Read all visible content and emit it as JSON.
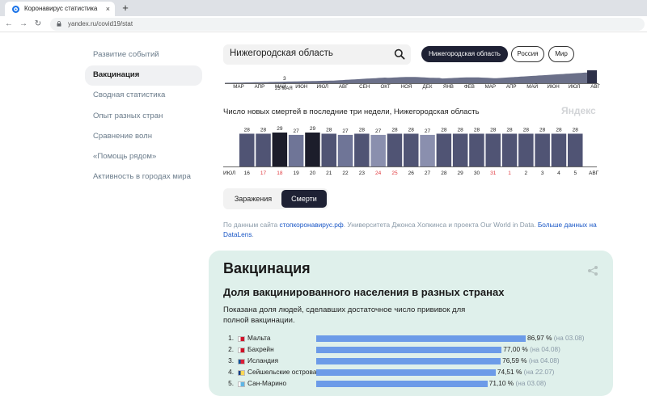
{
  "browser": {
    "tab_title": "Коронавирус статистика",
    "tab_close": "×",
    "new_tab": "+",
    "url": "yandex.ru/covid19/stat"
  },
  "sidebar": {
    "items": [
      {
        "label": "Развитие событий",
        "active": false
      },
      {
        "label": "Вакцинация",
        "active": true
      },
      {
        "label": "Сводная статистика",
        "active": false
      },
      {
        "label": "Опыт разных стран",
        "active": false
      },
      {
        "label": "Сравнение волн",
        "active": false
      },
      {
        "label": "«Помощь рядом»",
        "active": false
      },
      {
        "label": "Активность в городах мира",
        "active": false
      }
    ]
  },
  "region": {
    "search_value": "Нижегородская область",
    "pills": [
      "Нижегородская область",
      "Россия",
      "Мир"
    ]
  },
  "mini_chart": {
    "months": [
      "МАР",
      "АПР",
      "МАЙ",
      "ИЮН",
      "ИЮЛ",
      "АВГ",
      "СЕН",
      "ОКТ",
      "НОЯ",
      "ДЕК",
      "ЯНВ",
      "ФЕВ",
      "МАР",
      "АПР",
      "МАЙ",
      "ИЮН",
      "ИЮЛ",
      "АВГ"
    ],
    "marker_value": "3",
    "marker_date": "23 МАЯ"
  },
  "deaths_chart": {
    "title": "Число новых смертей в последние три недели, Нижегородская область",
    "brand": "Яндекс",
    "start_month": "ИЮЛ",
    "end_month": "АВГ"
  },
  "toggle": {
    "options": [
      "Заражения",
      "Смерти"
    ],
    "selected": 1
  },
  "sources": {
    "prefix": "По данным сайта ",
    "link1": "стопкоронавирус.рф",
    "middle": ". Университета Джонса Хопкинса и проекта Our World in Data. ",
    "link2": "Больше данных на DataLens",
    "suffix": "."
  },
  "vaccination": {
    "title": "Вакцинация",
    "subtitle": "Доля вакцинированного населения в разных странах",
    "description": "Показана доля людей, сделавших достаточное число прививок для полной вакцинации.",
    "rows": [
      {
        "rank": "1.",
        "country": "Мальта",
        "value": 86.97,
        "pct": "86,97 %",
        "when": "(на 03.08)",
        "flag": [
          "#ffffff",
          "#cf142b"
        ]
      },
      {
        "rank": "2.",
        "country": "Бахрейн",
        "value": 77.0,
        "pct": "77,00 %",
        "when": "(на 04.08)",
        "flag": [
          "#ffffff",
          "#ce1126"
        ]
      },
      {
        "rank": "3.",
        "country": "Исландия",
        "value": 76.59,
        "pct": "76,59 %",
        "when": "(на 04.08)",
        "flag": [
          "#02529c",
          "#dc1e35"
        ]
      },
      {
        "rank": "4.",
        "country": "Сейшельские острова",
        "value": 74.51,
        "pct": "74,51 %",
        "when": "(на 22.07)",
        "flag": [
          "#003f87",
          "#fcd856"
        ]
      },
      {
        "rank": "5.",
        "country": "Сан-Марино",
        "value": 71.1,
        "pct": "71,10 %",
        "when": "(на 03.08)",
        "flag": [
          "#ffffff",
          "#5eb6e4"
        ]
      }
    ]
  },
  "chart_data": {
    "type": "bar",
    "title": "Число новых смертей в последние три недели, Нижегородская область",
    "categories": [
      "16",
      "17",
      "18",
      "19",
      "20",
      "21",
      "22",
      "23",
      "24",
      "25",
      "26",
      "27",
      "28",
      "29",
      "30",
      "31",
      "1",
      "2",
      "3",
      "4",
      "5"
    ],
    "values": [
      28,
      28,
      29,
      27,
      29,
      28,
      27,
      28,
      27,
      28,
      28,
      27,
      28,
      28,
      28,
      28,
      28,
      28,
      28,
      28,
      28
    ],
    "weekend": [
      false,
      true,
      true,
      false,
      false,
      false,
      false,
      false,
      true,
      true,
      false,
      false,
      false,
      false,
      false,
      true,
      true,
      false,
      false,
      false,
      false
    ],
    "xlabel": "",
    "ylabel": "",
    "colors": {
      "base": "#505474",
      "dark": "#1c1d2b",
      "mid": "#6f7597",
      "light": "#8a8fae",
      "weekend_label": "#e0393e"
    },
    "shade": [
      "base",
      "base",
      "dark",
      "mid",
      "dark",
      "base",
      "mid",
      "base",
      "light",
      "base",
      "base",
      "light",
      "base",
      "base",
      "base",
      "base",
      "base",
      "base",
      "base",
      "base",
      "base"
    ]
  }
}
